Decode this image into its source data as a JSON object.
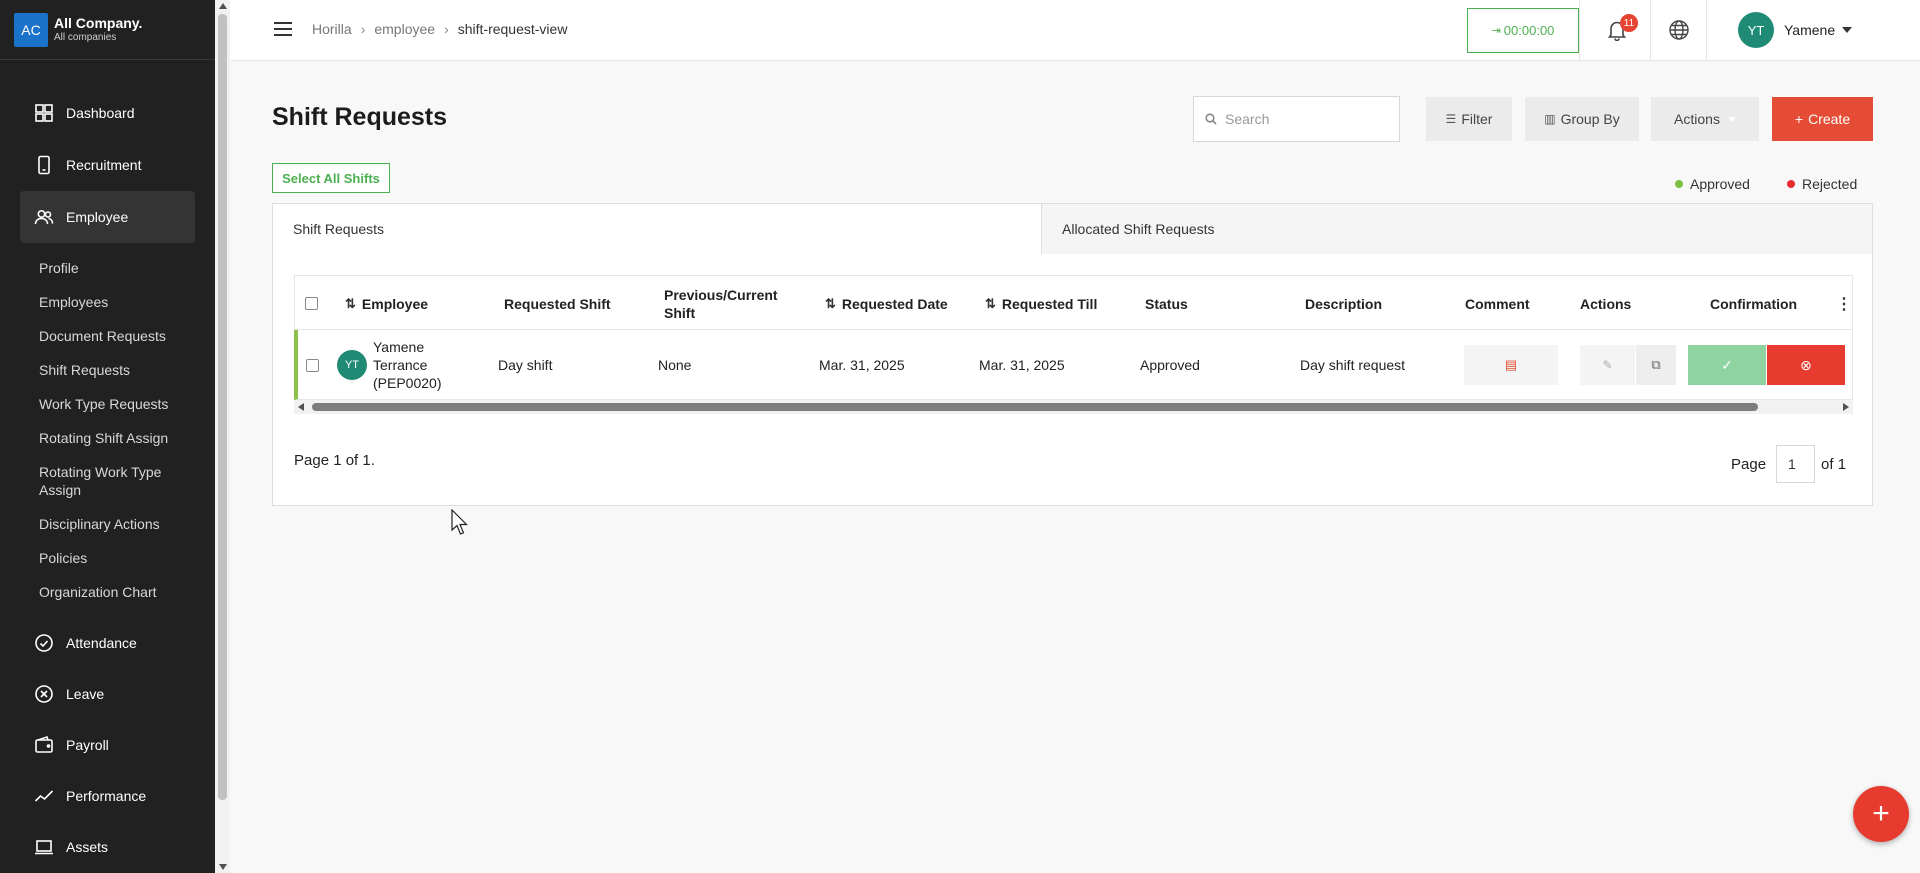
{
  "company": {
    "badge": "AC",
    "name": "All Company.",
    "sub": "All companies"
  },
  "sidebar": {
    "top_items": [
      {
        "label": "Dashboard",
        "icon": "grid-icon"
      },
      {
        "label": "Recruitment",
        "icon": "phone-icon"
      },
      {
        "label": "Employee",
        "icon": "users-icon"
      }
    ],
    "sub_items": [
      "Profile",
      "Employees",
      "Document Requests",
      "Shift Requests",
      "Work Type Requests",
      "Rotating Shift Assign",
      "Rotating Work Type Assign",
      "Disciplinary Actions",
      "Policies",
      "Organization Chart"
    ],
    "lower_items": [
      {
        "label": "Attendance",
        "icon": "check-circle-icon"
      },
      {
        "label": "Leave",
        "icon": "x-circle-icon"
      },
      {
        "label": "Payroll",
        "icon": "wallet-icon"
      },
      {
        "label": "Performance",
        "icon": "trend-icon"
      },
      {
        "label": "Assets",
        "icon": "laptop-icon"
      }
    ]
  },
  "topbar": {
    "breadcrumb": [
      "Horilla",
      "employee",
      "shift-request-view"
    ],
    "timer": "00:00:00",
    "notification_count": "11",
    "user": {
      "initials": "YT",
      "name": "Yamene"
    }
  },
  "page": {
    "title": "Shift Requests",
    "search_placeholder": "Search",
    "filter_label": "Filter",
    "group_by_label": "Group By",
    "actions_label": "Actions",
    "create_label": "Create",
    "select_all_label": "Select All Shifts",
    "legend": [
      {
        "label": "Approved",
        "color": "#7bc043"
      },
      {
        "label": "Rejected",
        "color": "#e62e2e"
      }
    ],
    "tabs": [
      "Shift Requests",
      "Allocated Shift Requests"
    ]
  },
  "table": {
    "headers": {
      "employee": "Employee",
      "requested_shift": "Requested Shift",
      "previous_shift": "Previous/Current Shift",
      "requested_date": "Requested Date",
      "requested_till": "Requested Till",
      "status": "Status",
      "description": "Description",
      "comment": "Comment",
      "actions": "Actions",
      "confirmation": "Confirmation"
    },
    "rows": [
      {
        "initials": "YT",
        "employee": "Yamene Terrance (PEP0020)",
        "requested_shift": "Day shift",
        "previous_shift": "None",
        "requested_date": "Mar. 31, 2025",
        "requested_till": "Mar. 31, 2025",
        "status": "Approved",
        "description": "Day shift request"
      }
    ]
  },
  "pagination": {
    "info": "Page 1 of 1.",
    "page_label": "Page",
    "current": "1",
    "of_label": "of 1"
  },
  "colors": {
    "accent": "#e54c35",
    "success": "#4caf50",
    "sidebar_bg": "#212121"
  }
}
